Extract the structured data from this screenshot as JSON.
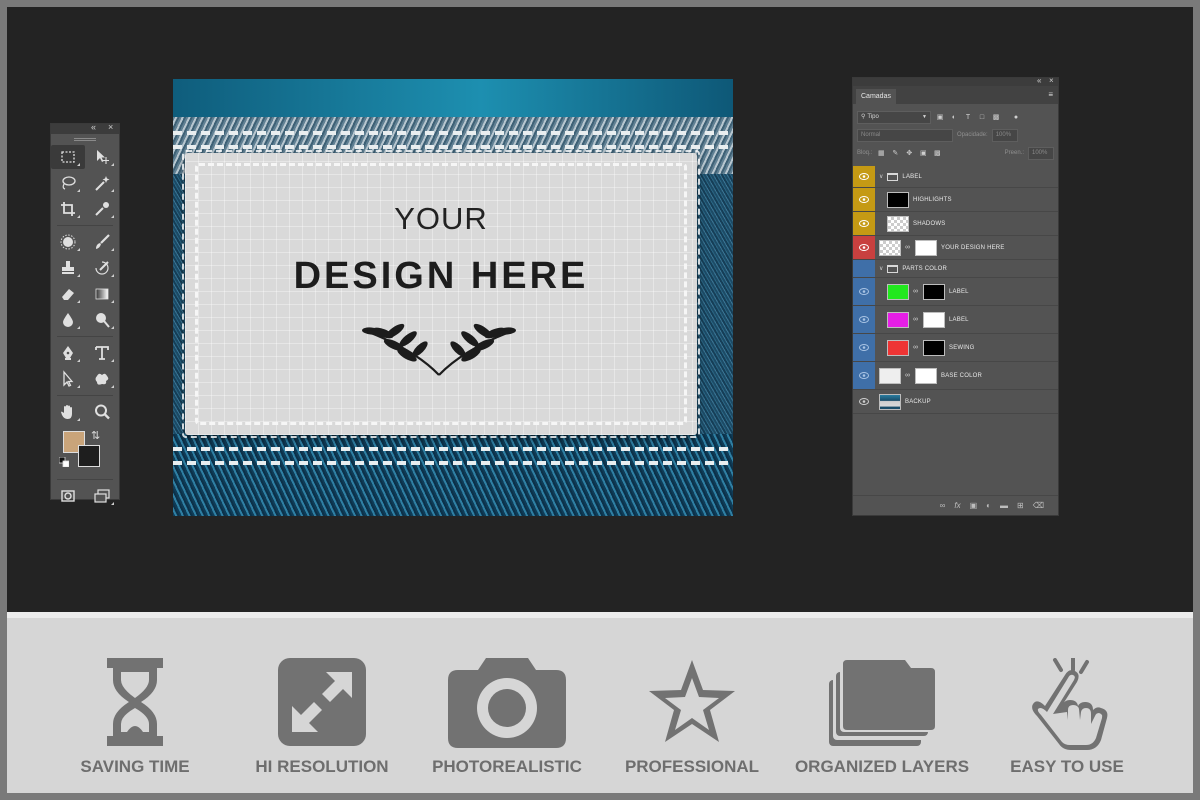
{
  "canvas": {
    "line1": "YOUR",
    "line2": "DESIGN HERE"
  },
  "toolbox": {
    "foreground_color": "#c9a47a",
    "background_color": "#1e1e1e"
  },
  "layers_panel": {
    "tab": "Camadas",
    "filter": "Tipo",
    "blend_mode": "Normal",
    "opacity_label": "Opacidade:",
    "opacity_value": "100%",
    "lock_label": "Bloq.:",
    "fill_label": "Preen.:",
    "fill_value": "100%",
    "layers": [
      {
        "name": "LABEL",
        "type": "group",
        "color": "#c59a14"
      },
      {
        "name": "HIGHLIGHTS",
        "type": "layer",
        "color": "#c59a14"
      },
      {
        "name": "SHADOWS",
        "type": "layer",
        "color": "#c59a14"
      },
      {
        "name": "YOUR DESIGN HERE",
        "type": "smart",
        "color": "#c8403f"
      },
      {
        "name": "PARTS COLOR",
        "type": "group",
        "color": "#3f6fa8"
      },
      {
        "name": "LABEL",
        "type": "fill",
        "swatch": "#22e81e",
        "color": "#3f6fa8"
      },
      {
        "name": "LABEL",
        "type": "fill",
        "swatch": "#e61ee6",
        "color": "#3f6fa8"
      },
      {
        "name": "SEWING",
        "type": "fill",
        "swatch": "#ee3434",
        "color": "#3f6fa8"
      },
      {
        "name": "BASE COLOR",
        "type": "fill",
        "swatch": "#eeeeee",
        "color": "#3f6fa8"
      },
      {
        "name": "BACKUP",
        "type": "image",
        "color": "#535353"
      }
    ]
  },
  "features": [
    {
      "label": "SAVING TIME",
      "icon": "hourglass-icon"
    },
    {
      "label": "HI RESOLUTION",
      "icon": "expand-icon"
    },
    {
      "label": "PHOTOREALISTIC",
      "icon": "camera-icon"
    },
    {
      "label": "PROFESSIONAL",
      "icon": "star-icon"
    },
    {
      "label": "ORGANIZED LAYERS",
      "icon": "folders-icon"
    },
    {
      "label": "EASY TO USE",
      "icon": "tap-hand-icon"
    }
  ]
}
